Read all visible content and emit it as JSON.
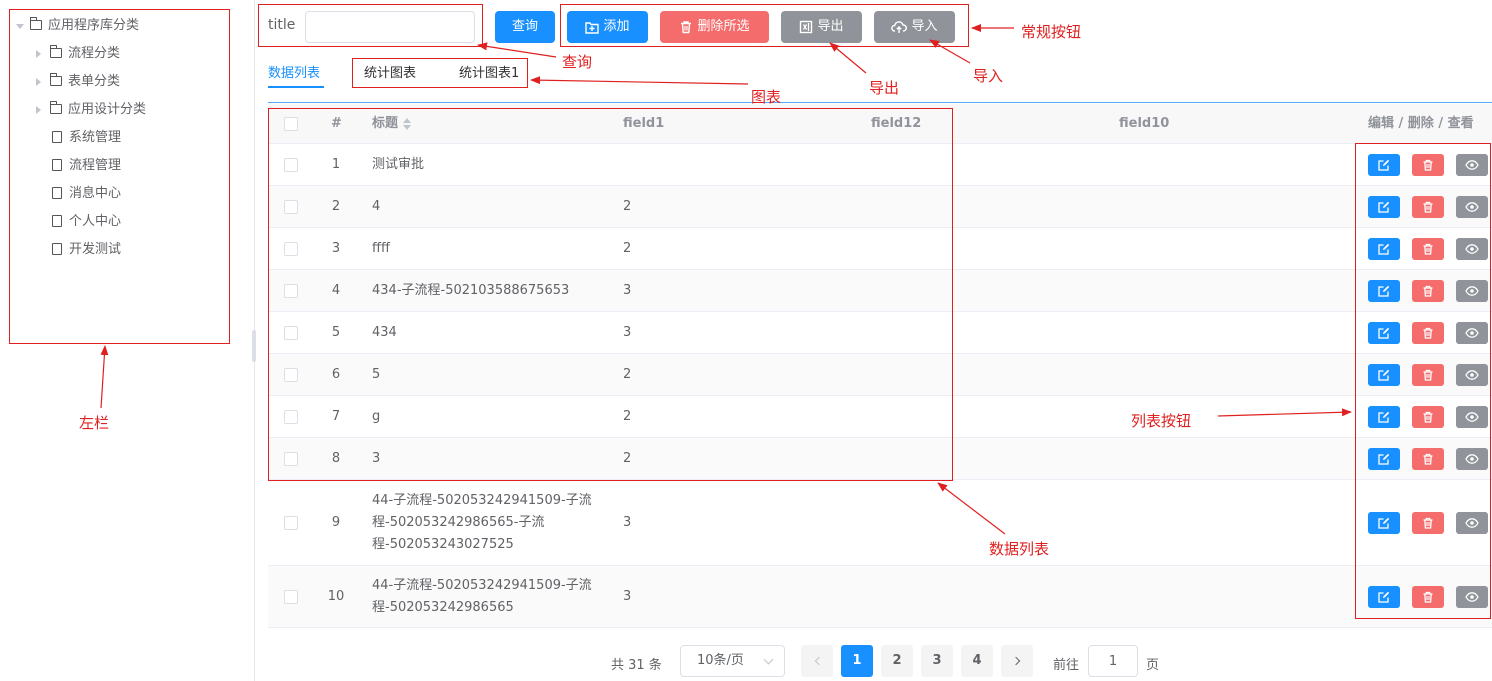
{
  "colors": {
    "primary": "#1890ff",
    "danger": "#f56c6c",
    "gray": "#909399",
    "annotation": "#e02020"
  },
  "sidebar": {
    "root": {
      "label": "应用程序库分类",
      "icon": "folder-icon",
      "expanded": true
    },
    "items": [
      {
        "label": "流程分类",
        "icon": "folder-icon",
        "type": "folder"
      },
      {
        "label": "表单分类",
        "icon": "folder-icon",
        "type": "folder"
      },
      {
        "label": "应用设计分类",
        "icon": "folder-icon",
        "type": "folder"
      },
      {
        "label": "系统管理",
        "icon": "document-icon",
        "type": "leaf"
      },
      {
        "label": "流程管理",
        "icon": "document-icon",
        "type": "leaf"
      },
      {
        "label": "消息中心",
        "icon": "document-icon",
        "type": "leaf"
      },
      {
        "label": "个人中心",
        "icon": "document-icon",
        "type": "leaf"
      },
      {
        "label": "开发测试",
        "icon": "document-icon",
        "type": "leaf"
      }
    ]
  },
  "search": {
    "label": "title",
    "value": "",
    "placeholder": "",
    "button": "查询"
  },
  "toolbar": {
    "add": {
      "label": "添加",
      "icon": "add-icon"
    },
    "delete": {
      "label": "删除所选",
      "icon": "trash-icon"
    },
    "export": {
      "label": "导出",
      "icon": "excel-icon"
    },
    "import": {
      "label": "导入",
      "icon": "cloud-upload-icon"
    }
  },
  "tabs": [
    {
      "label": "数据列表",
      "active": true
    },
    {
      "label": "统计图表",
      "active": false
    },
    {
      "label": "统计图表1",
      "active": false
    }
  ],
  "table": {
    "columns": {
      "index": "#",
      "title": "标题",
      "field1": "field1",
      "field12": "field12",
      "field10": "field10",
      "actions": "编辑 / 删除 / 查看"
    },
    "rows": [
      {
        "index": "1",
        "title": "测试审批",
        "field1": ""
      },
      {
        "index": "2",
        "title": "4",
        "field1": "2"
      },
      {
        "index": "3",
        "title": "ffff",
        "field1": "2"
      },
      {
        "index": "4",
        "title": "434-子流程-502103588675653",
        "field1": "3"
      },
      {
        "index": "5",
        "title": "434",
        "field1": "3"
      },
      {
        "index": "6",
        "title": "5",
        "field1": "2"
      },
      {
        "index": "7",
        "title": "g",
        "field1": "2"
      },
      {
        "index": "8",
        "title": "3",
        "field1": "2"
      },
      {
        "index": "9",
        "title": "44-子流程-502053242941509-子流程-502053242986565-子流程-502053243027525",
        "field1": "3"
      },
      {
        "index": "10",
        "title": "44-子流程-502053242941509-子流程-502053242986565",
        "field1": "3"
      }
    ],
    "row_actions": [
      "edit-icon",
      "trash-icon",
      "eye-icon"
    ]
  },
  "pagination": {
    "total_text": "共 31 条",
    "page_size": "10条/页",
    "pages": [
      "1",
      "2",
      "3",
      "4"
    ],
    "current": "1",
    "goto_prefix": "前往",
    "goto_value": "1",
    "goto_suffix": "页"
  },
  "annotations": {
    "sidebar": "左栏",
    "search": "查询",
    "toolbar": "常规按钮",
    "chart": "图表",
    "export": "导出",
    "import": "导入",
    "row_buttons": "列表按钮",
    "data_list": "数据列表"
  }
}
